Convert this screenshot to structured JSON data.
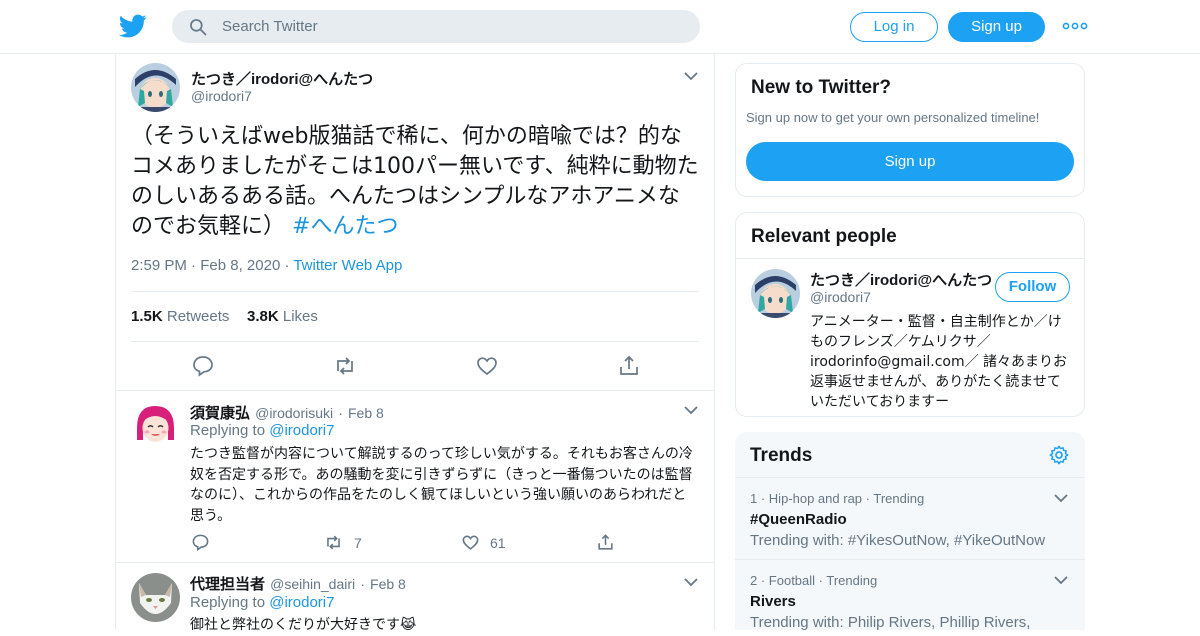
{
  "header": {
    "search_placeholder": "Search Twitter",
    "login_label": "Log in",
    "signup_label": "Sign up",
    "icons": [
      "twitter-logo-icon",
      "search-icon",
      "more-icon"
    ],
    "accent_color": "#1da1f2"
  },
  "main_tweet": {
    "display_name": "たつき／irodori@へんたつ",
    "handle": "@irodori7",
    "text": "（そういえばweb版猫話で稀に、何かの暗喩では？的なコメありましたがそこは100パー無いです、純粋に動物たのしいあるある話。へんたつはシンプルなアホアニメなのでお気軽に）",
    "hashtag": "#へんたつ",
    "time": "2:59 PM",
    "date": "Feb 8, 2020",
    "app": "Twitter Web App",
    "retweets_count": "1.5K",
    "retweets_label": "Retweets",
    "likes_count": "3.8K",
    "likes_label": "Likes"
  },
  "replies": [
    {
      "display_name": "須賀康弘",
      "handle": "@irodorisuki",
      "date": "Feb 8",
      "replying_label": "Replying to",
      "replying_to": "@irodori7",
      "text": "たつき監督が内容について解説するのって珍しい気がする。それもお客さんの冷奴を否定する形で。あの騒動を変に引きずらずに（きっと一番傷ついたのは監督なのに）、これからの作品をたのしく観てほしいという強い願いのあらわれだと思う。",
      "retweets": "7",
      "likes": "61"
    },
    {
      "display_name": "代理担当者",
      "handle": "@seihin_dairi",
      "date": "Feb 8",
      "replying_label": "Replying to",
      "replying_to": "@irodori7",
      "text": "御社と弊社のくだりが大好きです😹"
    }
  ],
  "new_to_twitter": {
    "title": "New to Twitter?",
    "subtitle": "Sign up now to get your own personalized timeline!",
    "signup_label": "Sign up"
  },
  "relevant_people": {
    "title": "Relevant people",
    "display_name": "たつき／irodori@へんたつ",
    "handle": "@irodori7",
    "follow_label": "Follow",
    "bio": "アニメーター・監督・自主制作とか／けものフレンズ／ケムリクサ／irodorinfo@gmail.com／ 諸々あまりお返事返せませんが、ありがたく読ませていただいておりますー"
  },
  "trends": {
    "title": "Trends",
    "items": [
      {
        "rank": "1",
        "category": "Hip-hop and rap",
        "status": "Trending",
        "name": "#QueenRadio",
        "with": "Trending with: #YikesOutNow, #YikeOutNow"
      },
      {
        "rank": "2",
        "category": "Football",
        "status": "Trending",
        "name": "Rivers",
        "with": "Trending with: Philip Rivers, Phillip Rivers,"
      }
    ]
  }
}
